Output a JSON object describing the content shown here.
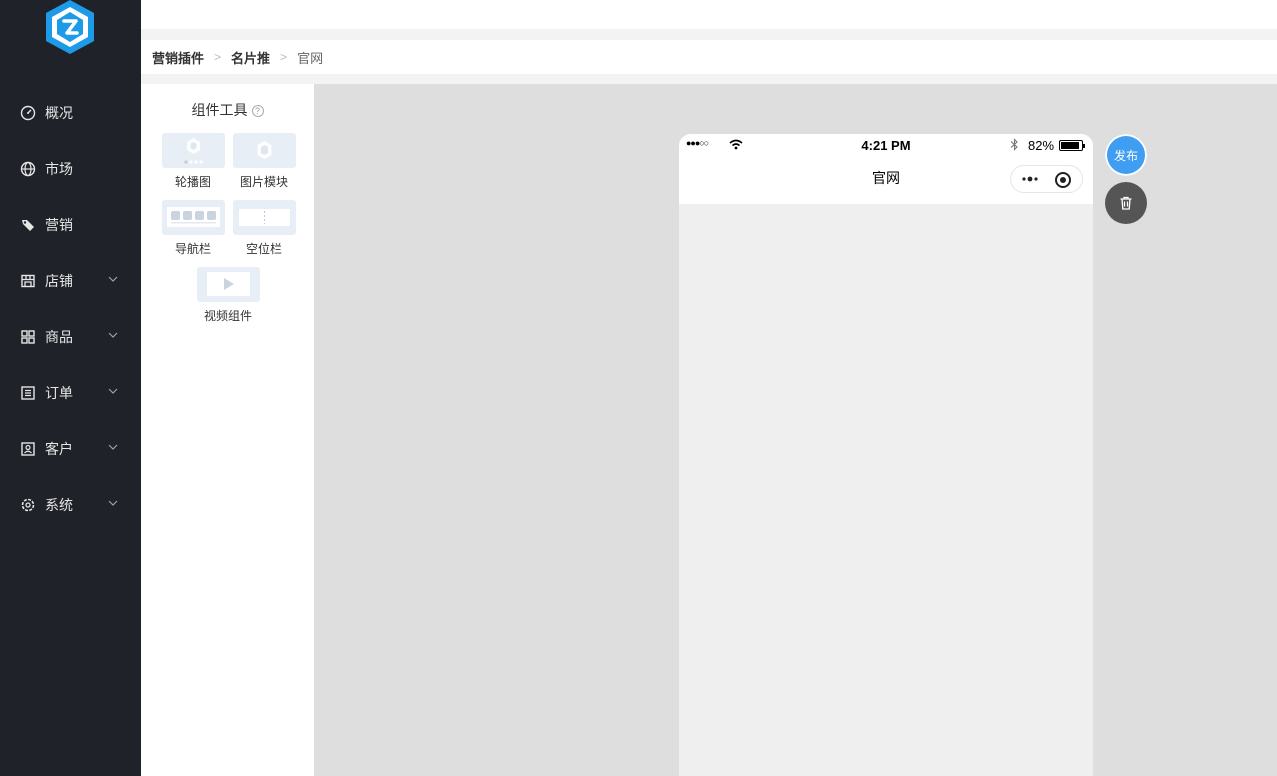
{
  "sidebar": {
    "items": [
      {
        "label": "概况",
        "icon": "dashboard-icon",
        "expandable": false
      },
      {
        "label": "市场",
        "icon": "globe-icon",
        "expandable": false
      },
      {
        "label": "营销",
        "icon": "tag-icon",
        "expandable": false
      },
      {
        "label": "店铺",
        "icon": "store-icon",
        "expandable": true
      },
      {
        "label": "商品",
        "icon": "grid-icon",
        "expandable": true
      },
      {
        "label": "订单",
        "icon": "list-icon",
        "expandable": true
      },
      {
        "label": "客户",
        "icon": "contact-icon",
        "expandable": true
      },
      {
        "label": "系统",
        "icon": "gear-icon",
        "expandable": true
      }
    ]
  },
  "breadcrumb": {
    "level1": "营销插件",
    "level2": "名片推",
    "current": "官网"
  },
  "tools": {
    "title": "组件工具",
    "help": "?",
    "items": [
      {
        "label": "轮播图",
        "icon": "carousel-icon"
      },
      {
        "label": "图片模块",
        "icon": "image-module-icon"
      },
      {
        "label": "导航栏",
        "icon": "navbar-icon"
      },
      {
        "label": "空位栏",
        "icon": "spacer-icon"
      },
      {
        "label": "视频组件",
        "icon": "video-icon"
      }
    ]
  },
  "phone": {
    "signal": "●●●○○",
    "time": "4:21 PM",
    "battery": "82%",
    "page_title": "官网"
  },
  "actions": {
    "publish": "发布"
  },
  "colors": {
    "sidebar_bg": "#20222a",
    "accent": "#3f9df2",
    "canvas_bg": "#dedede",
    "logo_blue": "#1e9be8"
  }
}
